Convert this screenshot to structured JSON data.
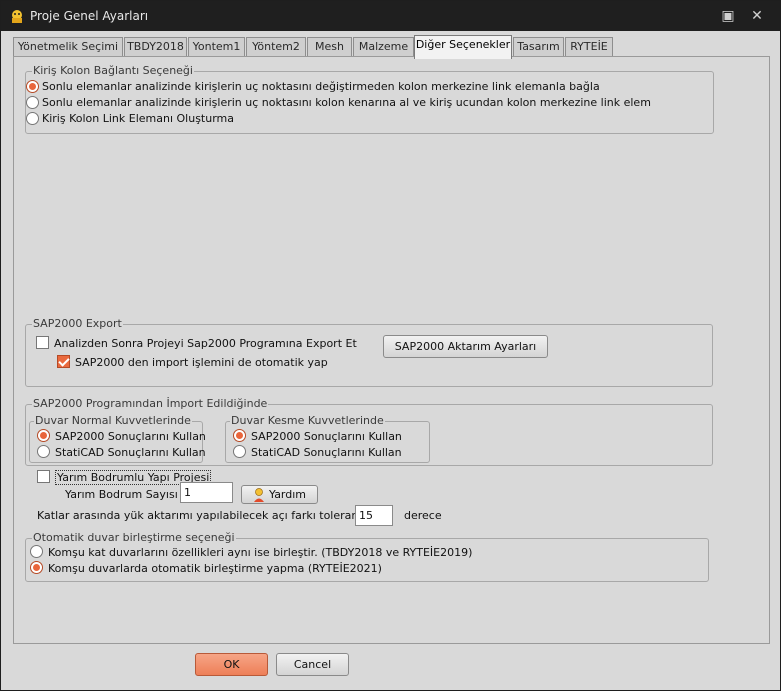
{
  "window": {
    "title": "Proje Genel Ayarları",
    "close_glyph": "✕"
  },
  "tabs": [
    {
      "label": "Yönetmelik Seçimi"
    },
    {
      "label": "TBDY2018"
    },
    {
      "label": "Yontem1"
    },
    {
      "label": "Yöntem2"
    },
    {
      "label": "Mesh"
    },
    {
      "label": "Malzeme"
    },
    {
      "label": "Diğer Seçenekler",
      "active": true
    },
    {
      "label": "Tasarım"
    },
    {
      "label": "RYTEİE"
    }
  ],
  "beam_column": {
    "title": "Kiriş Kolon Bağlantı Seçeneği",
    "options": [
      {
        "label": "Sonlu elemanlar analizinde kirişlerin uç noktasını değiştirmeden kolon merkezine link elemanla bağla",
        "selected": true
      },
      {
        "label": "Sonlu elemanlar analizinde kirişlerin uç noktasını kolon kenarına al ve kiriş ucundan kolon merkezine link elem",
        "selected": false
      },
      {
        "label": "Kiriş Kolon Link Elemanı Oluşturma",
        "selected": false
      }
    ]
  },
  "sap_export": {
    "title": "SAP2000 Export",
    "export_label": "Analizden Sonra Projeyi Sap2000 Programına Export Et",
    "export_checked": false,
    "import_label": "SAP2000 den import işlemini de otomatik yap",
    "import_checked": true,
    "settings_button": "SAP2000 Aktarım Ayarları"
  },
  "sap_import": {
    "title": "SAP2000 Programından İmport Edildiğinde",
    "normal": {
      "title": "Duvar Normal Kuvvetlerinde",
      "options": [
        {
          "label": "SAP2000 Sonuçlarını Kullan",
          "selected": true
        },
        {
          "label": "StatiCAD Sonuçlarını Kullan",
          "selected": false
        }
      ]
    },
    "shear": {
      "title": "Duvar Kesme Kuvvetlerinde",
      "options": [
        {
          "label": "SAP2000 Sonuçlarını Kullan",
          "selected": true
        },
        {
          "label": "StatiCAD Sonuçlarını Kullan",
          "selected": false
        }
      ]
    }
  },
  "basement": {
    "checkbox_label": "Yarım Bodrumlu Yapı Projesi",
    "checked": false,
    "count_label": "Yarım Bodrum Sayısı",
    "count_value": "1",
    "help_button": "Yardım"
  },
  "tolerance": {
    "label": "Katlar arasında yük aktarımı yapılabilecek açı farkı toleransı",
    "value": "15",
    "unit": "derece"
  },
  "wall_merge": {
    "title": "Otomatik duvar birleştirme seçeneği",
    "options": [
      {
        "label": "Komşu kat duvarlarını özellikleri aynı ise birleştir. (TBDY2018 ve RYTEİE2019)",
        "selected": false
      },
      {
        "label": "Komşu duvarlarda otomatik birleştirme yapma  (RYTEİE2021)",
        "selected": true
      }
    ]
  },
  "footer": {
    "ok_label": "OK",
    "cancel_label": "Cancel"
  },
  "colors": {
    "accent": "#ea6a3e",
    "title_bg": "#1f1f1f",
    "panel_bg": "#d9d9d9"
  }
}
